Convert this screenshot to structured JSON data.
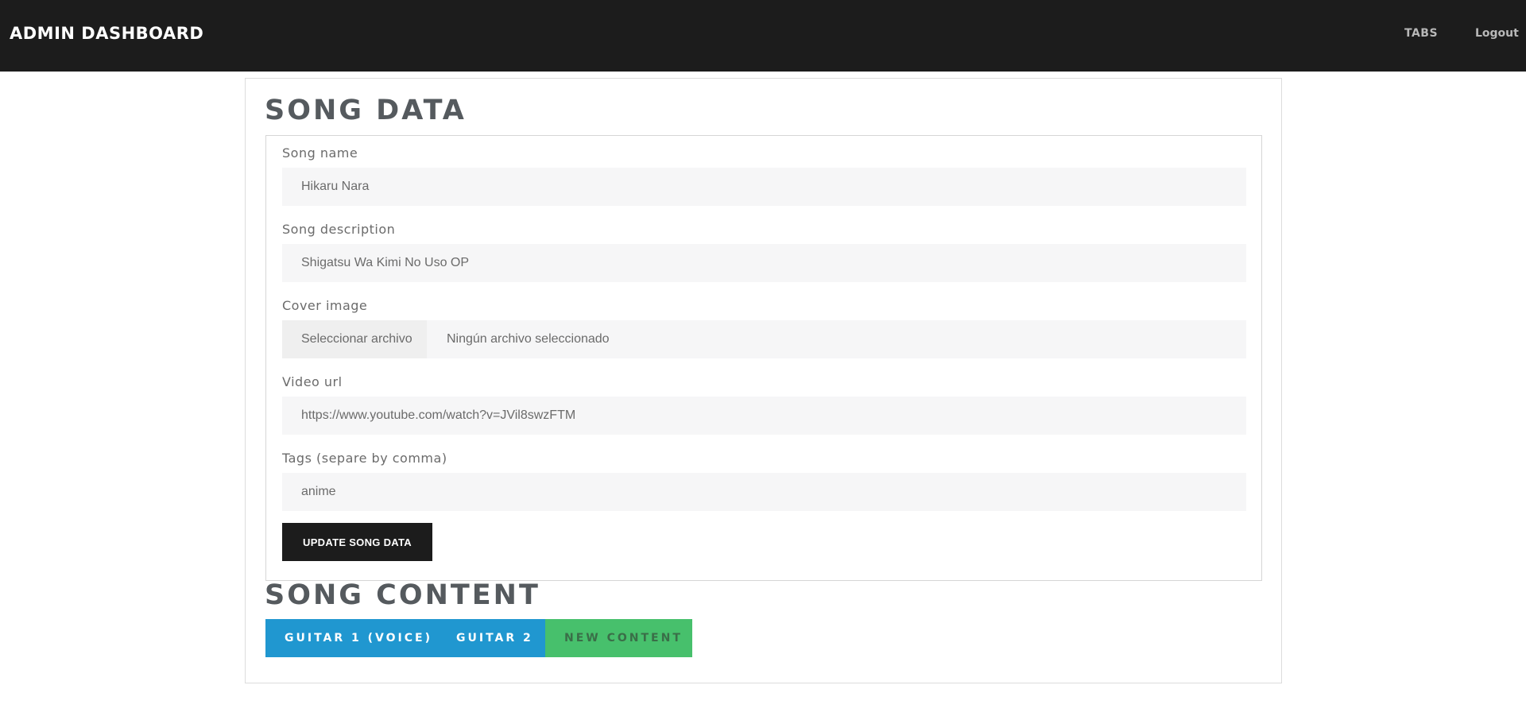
{
  "header": {
    "brand": "ADMIN DASHBOARD",
    "nav": {
      "tabs": "TABS",
      "logout": "Logout"
    },
    "background": "#1c1c1c"
  },
  "song_data": {
    "title": "SONG DATA",
    "fields": {
      "name": {
        "label": "Song name",
        "value": "Hikaru Nara"
      },
      "description": {
        "label": "Song description",
        "value": "Shigatsu Wa Kimi No Uso OP"
      },
      "cover": {
        "label": "Cover image",
        "button": "Seleccionar archivo",
        "status": "Ningún archivo seleccionado"
      },
      "video": {
        "label": "Video url",
        "value": "https://www.youtube.com/watch?v=JVil8swzFTM"
      },
      "tags": {
        "label": "Tags (separe by comma)",
        "value": "anime"
      }
    },
    "submit_label": "UPDATE SONG DATA"
  },
  "song_content": {
    "title": "SONG CONTENT",
    "tabs": [
      {
        "label": "GUITAR 1 (VOICE)",
        "color": "#2097d0"
      },
      {
        "label": "GUITAR 2",
        "color": "#2097d0"
      },
      {
        "label": "NEW CONTENT",
        "color": "#47c06c"
      }
    ]
  }
}
